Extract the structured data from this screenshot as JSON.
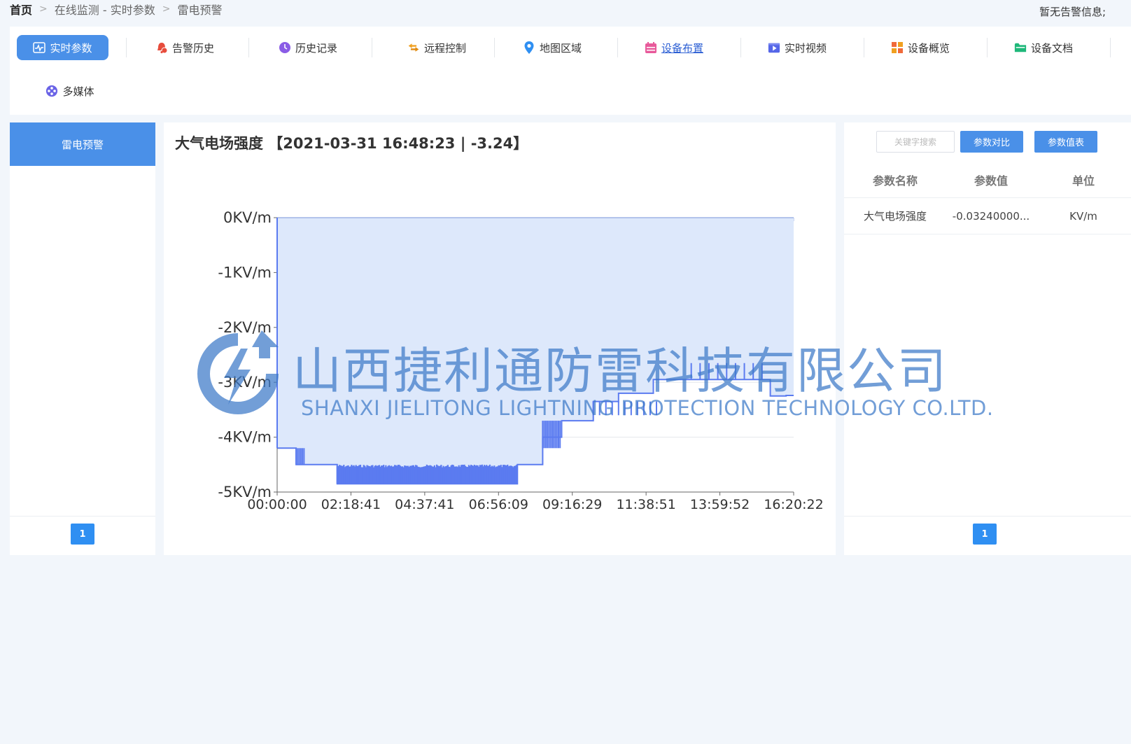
{
  "breadcrumb": {
    "home": "首页",
    "level1": "在线监测 - 实时参数",
    "level2": "雷电预警"
  },
  "alert_info": "暂无告警信息;",
  "nav": {
    "items": [
      {
        "label": "实时参数",
        "icon": "pulse-icon"
      },
      {
        "label": "告警历史",
        "icon": "bell-icon"
      },
      {
        "label": "历史记录",
        "icon": "clock-icon"
      },
      {
        "label": "远程控制",
        "icon": "swap-arrows-icon"
      },
      {
        "label": "地图区域",
        "icon": "map-pin-icon"
      },
      {
        "label": "设备布置",
        "icon": "calendar-icon"
      },
      {
        "label": "实时视频",
        "icon": "video-icon"
      },
      {
        "label": "设备概览",
        "icon": "grid-icon"
      },
      {
        "label": "设备文档",
        "icon": "folder-icon"
      },
      {
        "label": "多媒体",
        "icon": "film-reel-icon"
      }
    ],
    "active_index": 0,
    "underlined_index": 5
  },
  "left_panel": {
    "items": [
      "雷电预警"
    ],
    "page": "1"
  },
  "chart_panel": {
    "title": "大气电场强度 【2021-03-31 16:48:23 | -3.24】"
  },
  "chart_data": {
    "type": "area",
    "title": "大气电场强度 【2021-03-31 16:48:23 | -3.24】",
    "x_ticks": [
      "00:00:00",
      "02:18:41",
      "04:37:41",
      "06:56:09",
      "09:16:29",
      "11:38:51",
      "13:59:52",
      "16:20:22"
    ],
    "y_ticks": [
      "0KV/m",
      "-1KV/m",
      "-2KV/m",
      "-3KV/m",
      "-4KV/m",
      "-5KV/m"
    ],
    "ylim": [
      -5,
      0
    ],
    "xlim_hours": [
      0,
      16.34
    ],
    "series": [
      {
        "color": "#5b7bf0",
        "x_hours": [
          0,
          0.6,
          0.6,
          1.9,
          1.9,
          4.5,
          5.6,
          6.4,
          7.6,
          7.6,
          8.4,
          8.4,
          9.0,
          9.0,
          10.0,
          10.0,
          10.8,
          10.8,
          11.9,
          11.9,
          12.3,
          12.3,
          15.6,
          15.6,
          16.1,
          16.1,
          16.34
        ],
        "y_kv": [
          -4.2,
          -4.2,
          -4.5,
          -4.5,
          -4.85,
          -4.85,
          -4.85,
          -4.85,
          -4.85,
          -4.5,
          -4.5,
          -4.0,
          -4.0,
          -3.7,
          -3.7,
          -3.35,
          -3.35,
          -3.2,
          -3.2,
          -2.95,
          -2.95,
          -2.95,
          -2.95,
          -3.25,
          -3.25,
          -3.24,
          -3.24
        ]
      }
    ],
    "area_fill": "#dde8fb",
    "grid": true
  },
  "right_panel": {
    "search_placeholder": "关键字搜索",
    "compare_button": "参数对比",
    "table_button": "参数值表",
    "columns": [
      "参数名称",
      "参数值",
      "单位"
    ],
    "rows": [
      [
        "大气电场强度",
        "-0.03240000...",
        "KV/m"
      ]
    ],
    "page": "1"
  },
  "watermark": {
    "cn": "山西捷利通防雷科技有限公司",
    "en": "SHANXI JIELITONG LIGHTNING PROTECTION TECHNOLOGY CO.LTD."
  }
}
